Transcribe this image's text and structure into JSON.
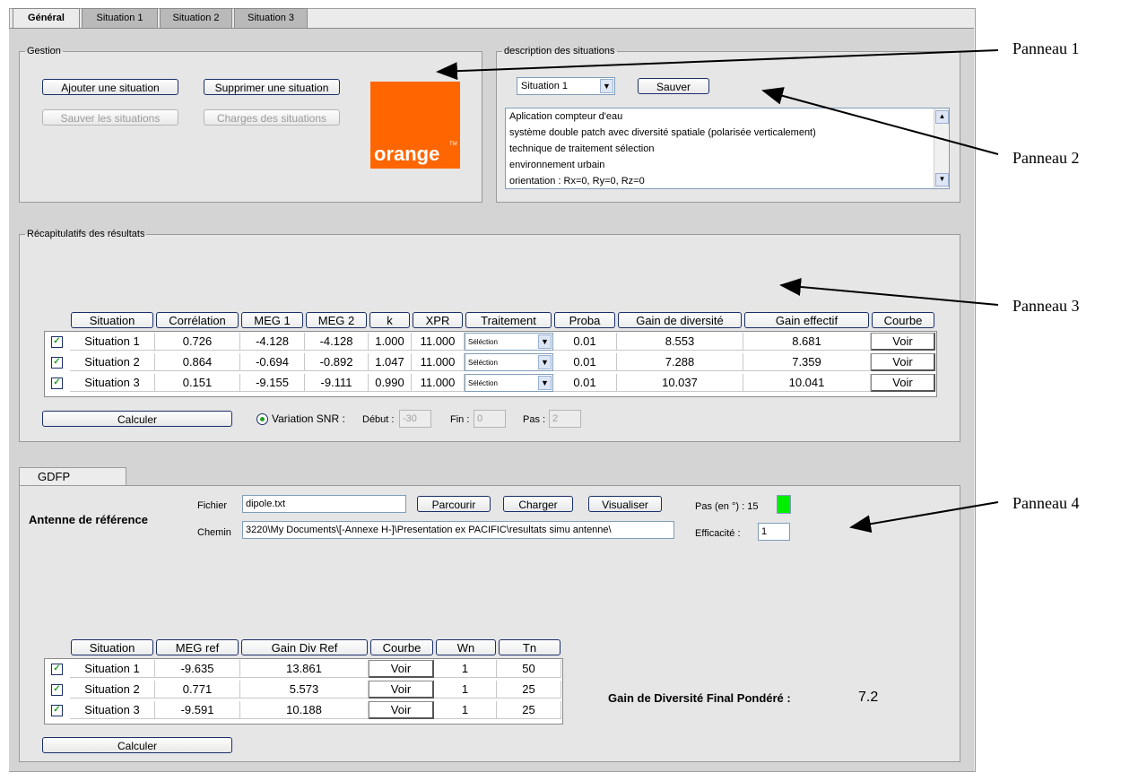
{
  "tabs": [
    "Général",
    "Situation 1",
    "Situation 2",
    "Situation 3"
  ],
  "gestion": {
    "legend": "Gestion",
    "add_button": "Ajouter une situation",
    "remove_button": "Supprimer une situation",
    "save_button": "Sauver les situations",
    "load_button": "Charges des situations",
    "logo_text": "orange",
    "logo_tm": "TM"
  },
  "description": {
    "legend": "description des situations",
    "selected_situation": "Situation 1",
    "save_button": "Sauver",
    "lines": [
      "Aplication compteur d'eau",
      "système double patch avec diversité spatiale (polarisée verticalement)",
      "technique de traitement sélection",
      "environnement urbain",
      "orientation : Rx=0, Ry=0, Rz=0"
    ]
  },
  "results": {
    "legend": "Récapitulatifs des résultats",
    "headers": [
      "Situation",
      "Corrélation",
      "MEG 1",
      "MEG 2",
      "k",
      "XPR",
      "Traitement",
      "Proba",
      "Gain de diversité",
      "Gain effectif",
      "Courbe"
    ],
    "rows": [
      {
        "situation": "Situation 1",
        "correlation": "0.726",
        "meg1": "-4.128",
        "meg2": "-4.128",
        "k": "1.000",
        "xpr": "11.000",
        "traitement": "Séléction",
        "proba": "0.01",
        "gain_div": "8.553",
        "gain_eff": "8.681",
        "courbe": "Voir"
      },
      {
        "situation": "Situation 2",
        "correlation": "0.864",
        "meg1": "-0.694",
        "meg2": "-0.892",
        "k": "1.047",
        "xpr": "11.000",
        "traitement": "Séléction",
        "proba": "0.01",
        "gain_div": "7.288",
        "gain_eff": "7.359",
        "courbe": "Voir"
      },
      {
        "situation": "Situation 3",
        "correlation": "0.151",
        "meg1": "-9.155",
        "meg2": "-9.111",
        "k": "0.990",
        "xpr": "11.000",
        "traitement": "Séléction",
        "proba": "0.01",
        "gain_div": "10.037",
        "gain_eff": "10.041",
        "courbe": "Voir"
      }
    ],
    "calc_button": "Calculer",
    "snr_label": "Variation SNR :",
    "debut_label": "Début :",
    "debut_value": "-30",
    "fin_label": "Fin :",
    "fin_value": "0",
    "pas_label": "Pas :",
    "pas_value": "2"
  },
  "gdfp": {
    "tab_label": "GDFP",
    "ref_antenna_label": "Antenne de référence",
    "fichier_label": "Fichier",
    "fichier_value": "dipole.txt",
    "chemin_label": "Chemin",
    "chemin_value": "3220\\My Documents\\[-Annexe H-]\\Presentation ex PACIFIC\\resultats simu antenne\\",
    "browse_button": "Parcourir",
    "load_button": "Charger",
    "view_button": "Visualiser",
    "pas_label": "Pas (en °) : 15",
    "efficacite_label": "Efficacité :",
    "efficacite_value": "1",
    "headers": [
      "Situation",
      "MEG ref",
      "Gain Div Ref",
      "Courbe",
      "Wn",
      "Tn"
    ],
    "rows": [
      {
        "situation": "Situation 1",
        "meg_ref": "-9.635",
        "gain_div_ref": "13.861",
        "courbe": "Voir",
        "wn": "1",
        "tn": "50"
      },
      {
        "situation": "Situation 2",
        "meg_ref": "0.771",
        "gain_div_ref": "5.573",
        "courbe": "Voir",
        "wn": "1",
        "tn": "25"
      },
      {
        "situation": "Situation 3",
        "meg_ref": "-9.591",
        "gain_div_ref": "10.188",
        "courbe": "Voir",
        "wn": "1",
        "tn": "25"
      }
    ],
    "final_label": "Gain de Diversité Final Pondéré :",
    "final_value": "7.2",
    "calc_button": "Calculer"
  },
  "annotations": [
    "Panneau 1",
    "Panneau 2",
    "Panneau 3",
    "Panneau 4"
  ],
  "colors": {
    "orange": "#ff6600",
    "indicator_green": "#00ee00"
  }
}
